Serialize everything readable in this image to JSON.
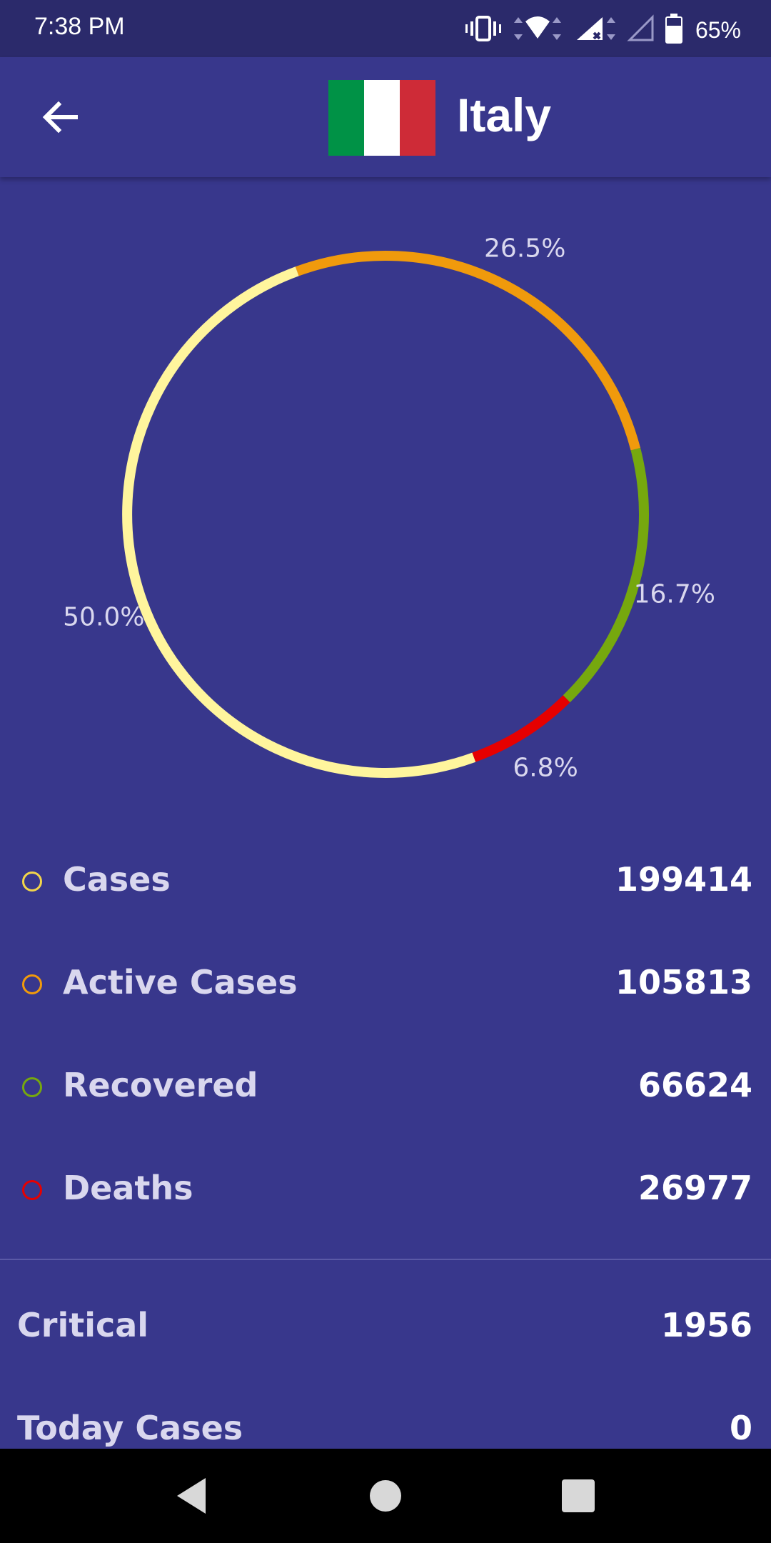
{
  "status_bar": {
    "time": "7:38 PM",
    "battery": "65%",
    "icons": [
      "vibrate-icon",
      "wifi-icon",
      "cell-signal-icon",
      "no-signal-icon",
      "battery-icon"
    ]
  },
  "app_bar": {
    "title": "Italy",
    "back_icon": "arrow-left-icon",
    "flag_colors": [
      "#009246",
      "#ffffff",
      "#ce2b37"
    ]
  },
  "chart_data": {
    "type": "pie",
    "style": "donut-ring",
    "slices": [
      {
        "name": "Cases",
        "percent": 50.0,
        "label": "50.0%",
        "color": "#fff59d"
      },
      {
        "name": "Active Cases",
        "percent": 26.5,
        "label": "26.5%",
        "color": "#f09a0c"
      },
      {
        "name": "Recovered",
        "percent": 16.7,
        "label": "16.7%",
        "color": "#76a80e"
      },
      {
        "name": "Deaths",
        "percent": 6.8,
        "label": "6.8%",
        "color": "#e60000"
      }
    ]
  },
  "stats": [
    {
      "label": "Cases",
      "value": "199414",
      "color": "#f2d54a"
    },
    {
      "label": "Active Cases",
      "value": "105813",
      "color": "#f09a0c"
    },
    {
      "label": "Recovered",
      "value": "66624",
      "color": "#76a80e"
    },
    {
      "label": "Deaths",
      "value": "26977",
      "color": "#e60000"
    }
  ],
  "extra_stats": [
    {
      "label": "Critical",
      "value": "1956"
    },
    {
      "label": "Today Cases",
      "value": "0"
    }
  ],
  "nav_bar": {
    "back": "nav-back-icon",
    "home": "nav-home-icon",
    "recents": "nav-recents-icon"
  },
  "colors": {
    "background": "#38378c",
    "status_bar": "#2b2a6b",
    "label_text": "#d9d7ee",
    "value_text": "#ffffff"
  }
}
